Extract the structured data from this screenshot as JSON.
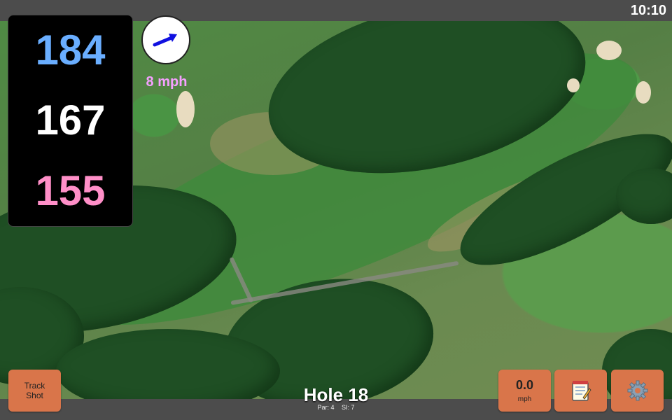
{
  "status": {
    "time": "10:10"
  },
  "distances": {
    "back": "184",
    "middle": "167",
    "front": "155"
  },
  "wind": {
    "speed": "8 mph",
    "icon": "wind-direction-arrow-icon"
  },
  "buttons": {
    "track_shot": "Track\nShot",
    "speed_value": "0.0",
    "speed_unit": "mph",
    "notes_icon": "notepad-icon",
    "settings_icon": "gear-icon"
  },
  "hole": {
    "title": "Hole 18",
    "par": "Par: 4",
    "si": "SI: 7"
  },
  "colors": {
    "back_distance": "#6aaeff",
    "middle_distance": "#ffffff",
    "front_distance": "#ff8fc8",
    "wind_text": "#f5a0ff",
    "button": "#d9754a",
    "bar": "#4c4c4c"
  }
}
